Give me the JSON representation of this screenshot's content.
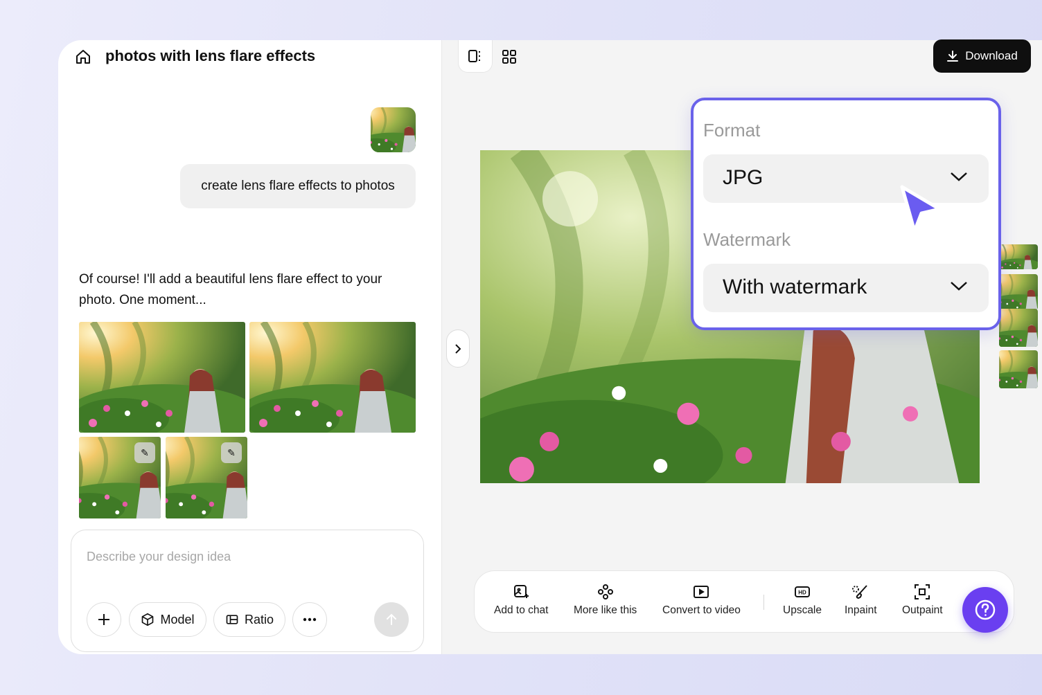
{
  "header": {
    "title": "photos with lens flare effects"
  },
  "chat": {
    "user_message": "create lens flare effects to photos",
    "assistant_reply": "Of course! I'll add a beautiful lens flare effect to your photo. One moment..."
  },
  "composer": {
    "placeholder": "Describe your design idea",
    "model_label": "Model",
    "ratio_label": "Ratio"
  },
  "download": {
    "label": "Download"
  },
  "popover": {
    "format_label": "Format",
    "format_value": "JPG",
    "watermark_label": "Watermark",
    "watermark_value": "With watermark"
  },
  "toolbar": {
    "add_to_chat": "Add to chat",
    "more_like_this": "More like this",
    "convert_to_video": "Convert to video",
    "upscale": "Upscale",
    "inpaint": "Inpaint",
    "outpaint": "Outpaint"
  },
  "icons": {
    "home": "home-icon",
    "split_view": "split-view-icon",
    "grid_view": "grid-view-icon",
    "download": "download-icon",
    "chevron": "chevron-down-icon",
    "help": "help-icon"
  },
  "colors": {
    "accent": "#6a62ea",
    "help_button": "#6a3ff0",
    "download_bg": "#0f0f0f"
  }
}
